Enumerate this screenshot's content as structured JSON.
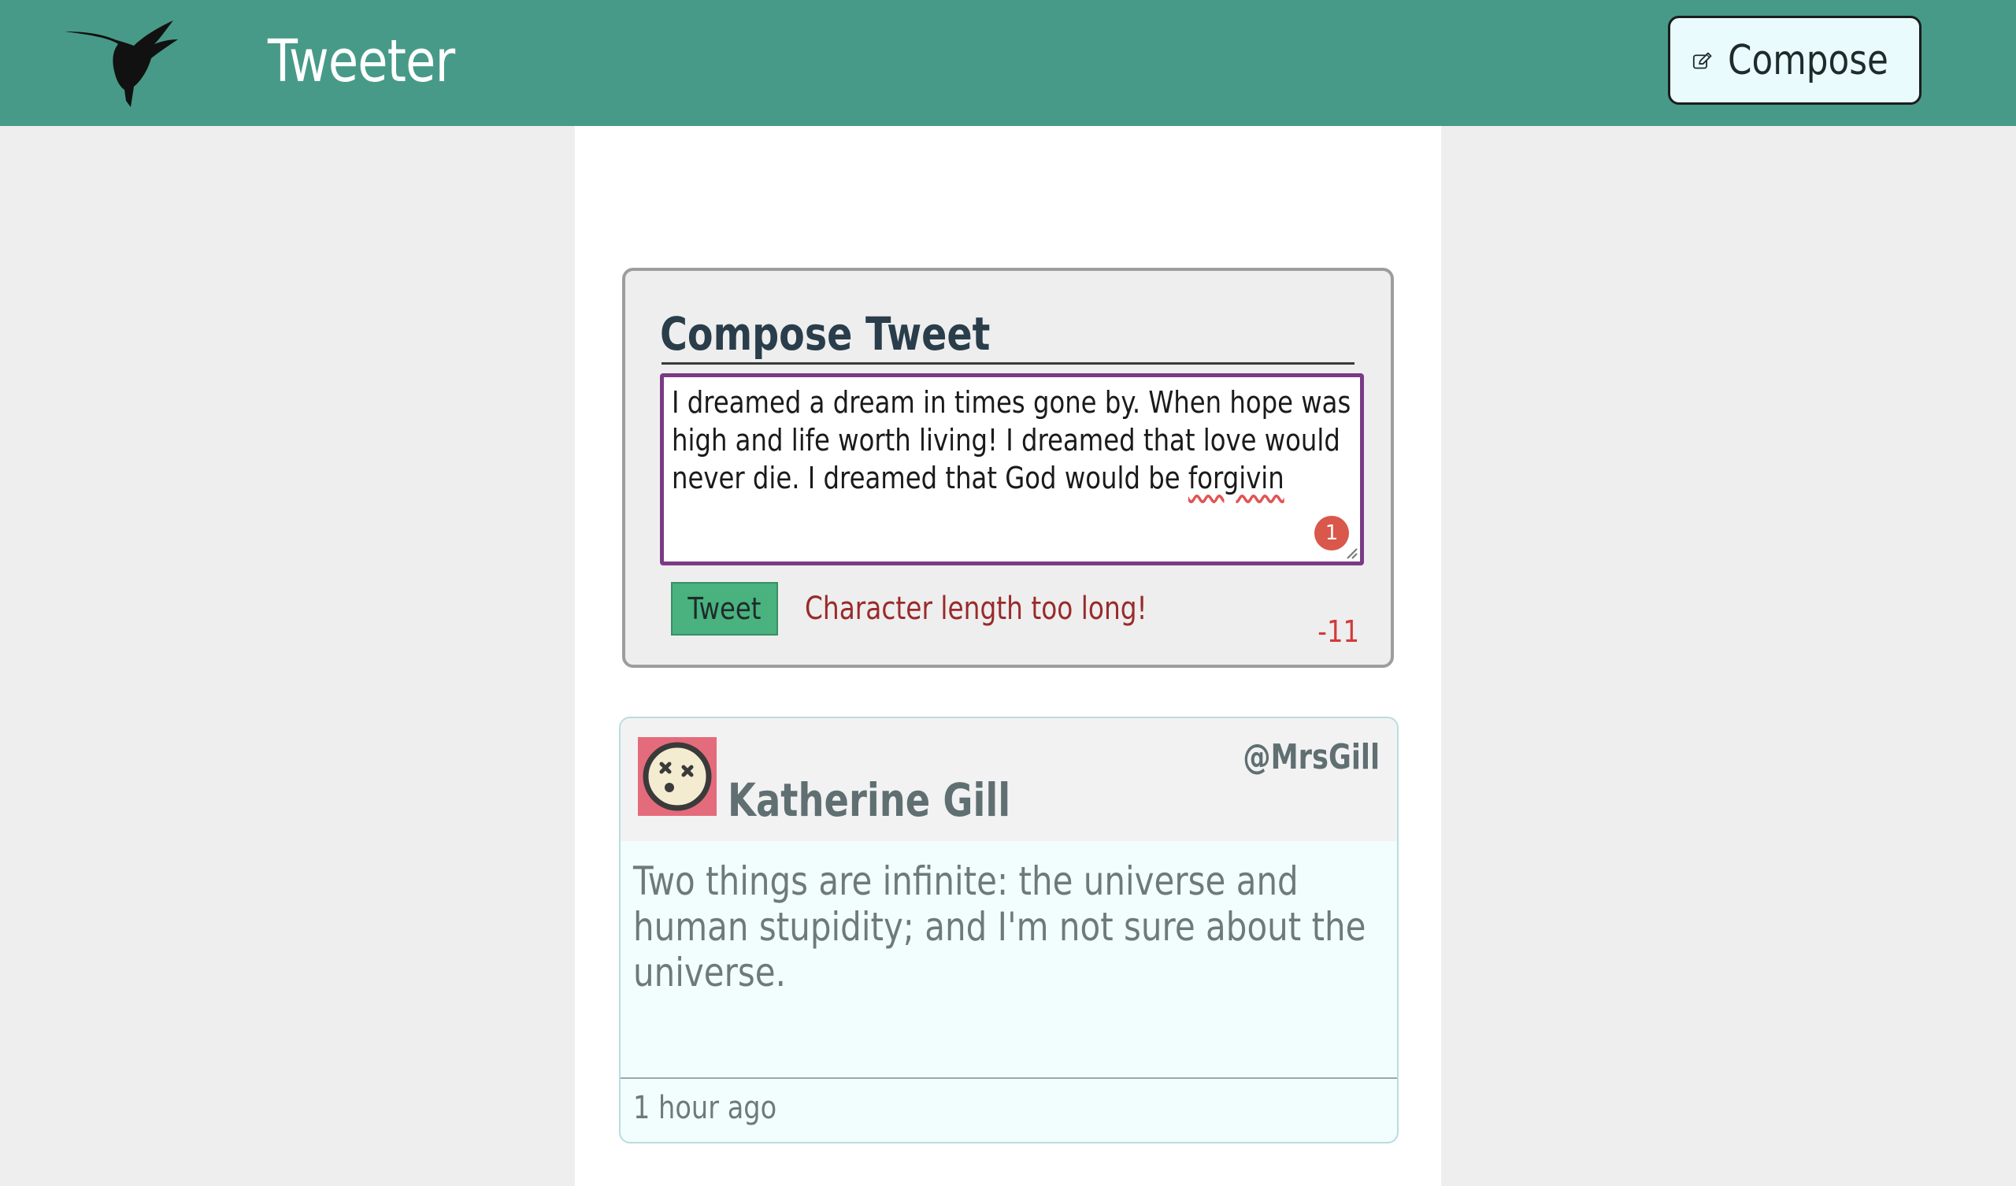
{
  "app": {
    "name": "Tweeter",
    "logo_icon": "hummingbird-logo-icon"
  },
  "header": {
    "compose_label": "Compose",
    "compose_icon": "edit-pencil-icon"
  },
  "compose": {
    "title": "Compose Tweet",
    "text_before": "I dreamed a dream in times gone by. When hope was high and life worth living! I dreamed that love would never die. I dreamed that God would be ",
    "text_misspelled": "forgivin",
    "grammar_issue_count": "1",
    "tweet_button_label": "Tweet",
    "error_message": "Character length too long!",
    "char_counter": "-11"
  },
  "tweets": [
    {
      "avatar_icon": "dizzy-face-avatar-icon",
      "name": "Katherine Gill",
      "handle": "@MrsGill",
      "content": "Two things are infinite: the universe and human stupidity; and I'm not sure about the universe.",
      "timestamp": "1 hour ago"
    }
  ],
  "colors": {
    "header_bg": "#479a88",
    "page_bg": "#eeeeee",
    "tweet_button_bg": "#49b27f",
    "error_text": "#9a2a2a",
    "counter_negative": "#d23a3a",
    "textarea_focus_border": "#7a3a86",
    "avatar_bg": "#e46b7b"
  }
}
